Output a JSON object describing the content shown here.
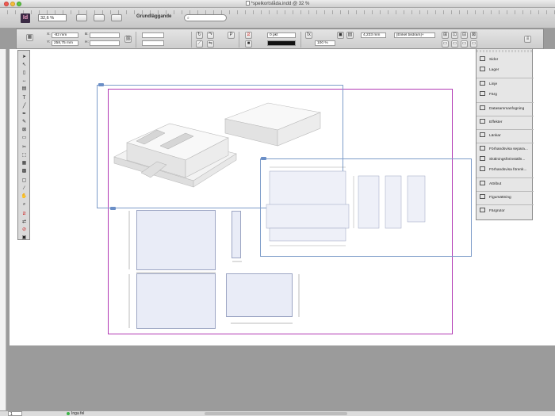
{
  "window": {
    "title": "*spelkortslåda.indd @ 32 %"
  },
  "app_bar": {
    "app_logo": "Id",
    "zoom": "32,6 %",
    "workspace": "Grundläggande",
    "search_placeholder": ""
  },
  "control_panel": {
    "x_label": "X:",
    "x_value": "-82 mm",
    "y_label": "Y:",
    "y_value": "258,75 mm",
    "b_label": "B:",
    "h_label": "H:",
    "stroke_weight": "0 pkt",
    "percent": "100 %",
    "measure": "4,233 mm",
    "frame_style": "[Enkel bildram]+"
  },
  "tools": [
    "selection",
    "direct-selection",
    "page",
    "gap",
    "content-collector",
    "type",
    "line",
    "pen",
    "pencil",
    "frame-rect",
    "rect",
    "scissors",
    "free-transform",
    "gradient",
    "gradient-feather",
    "note",
    "eyedropper",
    "hand",
    "zoom",
    "fill-stroke",
    "swap",
    "default",
    "apply",
    "view-mode"
  ],
  "panels": [
    {
      "label": "Sidor",
      "icon": "pages-icon"
    },
    {
      "label": "Lager",
      "icon": "layers-icon"
    },
    {
      "label": "Linje",
      "icon": "stroke-icon"
    },
    {
      "label": "Färg",
      "icon": "color-icon"
    },
    {
      "label": "Datasammanfogning",
      "icon": "data-merge-icon"
    },
    {
      "label": "Effekter",
      "icon": "effects-icon"
    },
    {
      "label": "Länkar",
      "icon": "links-icon"
    },
    {
      "label": "Förhandsvisa separa...",
      "icon": "separations-icon"
    },
    {
      "label": "Skälningsförinställn...",
      "icon": "flattener-icon"
    },
    {
      "label": "Förhandsvisa förenk...",
      "icon": "flattener-preview-icon"
    },
    {
      "label": "Attribut",
      "icon": "attributes-icon"
    },
    {
      "label": "Figursättning",
      "icon": "text-wrap-icon"
    },
    {
      "label": "Färgrutor",
      "icon": "swatches-icon"
    }
  ],
  "status": {
    "page": "1",
    "preflight": "Inga fel"
  },
  "colors": {
    "page_border": "#b23ab4",
    "frame": "#7d9cc9",
    "dieline_fill": "#e9ecf7",
    "status_ok": "#3bb346"
  }
}
